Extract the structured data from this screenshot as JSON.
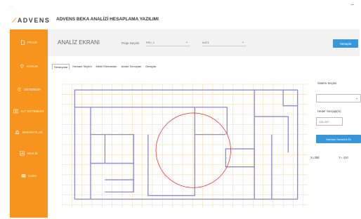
{
  "window": {
    "minimize": "–",
    "corner": "·"
  },
  "header": {
    "logo": "ADVENS",
    "title": "ADVENS BEKA ANALİZİ HESAPLAMA YAZILIMI"
  },
  "sidebar": {
    "items": [
      {
        "label": "PROJE",
        "icon": "file-icon"
      },
      {
        "label": "KONUM",
        "icon": "location-icon"
      },
      {
        "label": "SİSTEMLER",
        "icon": "settings-icon"
      },
      {
        "label": "ALT SİSTEMLER",
        "icon": "list-icon"
      },
      {
        "label": "SENARYOLAR",
        "icon": "bell-icon"
      },
      {
        "label": "ANALİZ",
        "icon": "chart-icon"
      },
      {
        "label": "ÇIZIM",
        "icon": "drawing-icon"
      }
    ]
  },
  "topbar": {
    "screen_title": "ANALİZ EKRANI",
    "project_label": "Proje Seçimi",
    "project_value": "PRJ_1",
    "second_value": "KAT1",
    "calc_button": "Hesapla"
  },
  "tabs": [
    "Senaryolar",
    "Hamam Seçimi",
    "Metin Elemanları",
    "Analiz Sonuçları",
    "Detaylar"
  ],
  "panel": {
    "system_label": "Sistem Seçimi",
    "radius_label": "Hedef Yarıçap(m)",
    "radius_value": "116,347",
    "place_button": "Hamam Sensörü Ek",
    "x_readout": "X=358",
    "y_readout": "Y= 410"
  },
  "colors": {
    "accent": "#f7941d",
    "button": "#3498db",
    "wall": "#8c8cd4",
    "grid": "#f1d8a8",
    "circle": "#e33b3b"
  }
}
